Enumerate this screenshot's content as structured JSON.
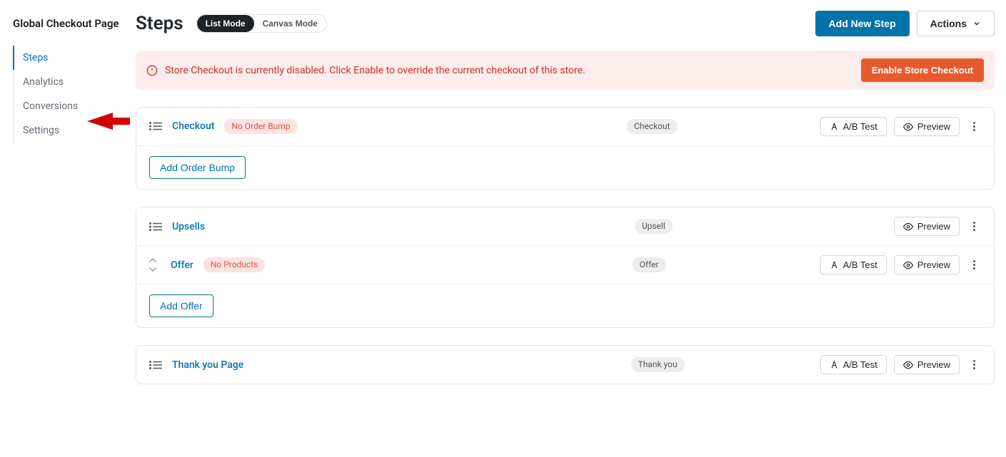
{
  "sidebar": {
    "title": "Global Checkout Page",
    "items": [
      "Steps",
      "Analytics",
      "Conversions",
      "Settings"
    ],
    "active_index": 0
  },
  "header": {
    "title": "Steps",
    "mode_list": "List Mode",
    "mode_canvas": "Canvas Mode",
    "add_button": "Add New Step",
    "actions_button": "Actions"
  },
  "notice": {
    "text": "Store Checkout is currently disabled. Click Enable to override the current checkout of this store.",
    "cta": "Enable Store Checkout"
  },
  "buttons": {
    "abtest": "A/B Test",
    "preview": "Preview",
    "add_order_bump": "Add Order Bump",
    "add_offer": "Add Offer"
  },
  "steps": {
    "checkout": {
      "name": "Checkout",
      "badge": "No Order Bump",
      "type": "Checkout"
    },
    "upsells": {
      "name": "Upsells",
      "type": "Upsell"
    },
    "offer": {
      "name": "Offer",
      "badge": "No Products",
      "type": "Offer"
    },
    "thankyou": {
      "name": "Thank you Page",
      "type": "Thank you"
    }
  }
}
